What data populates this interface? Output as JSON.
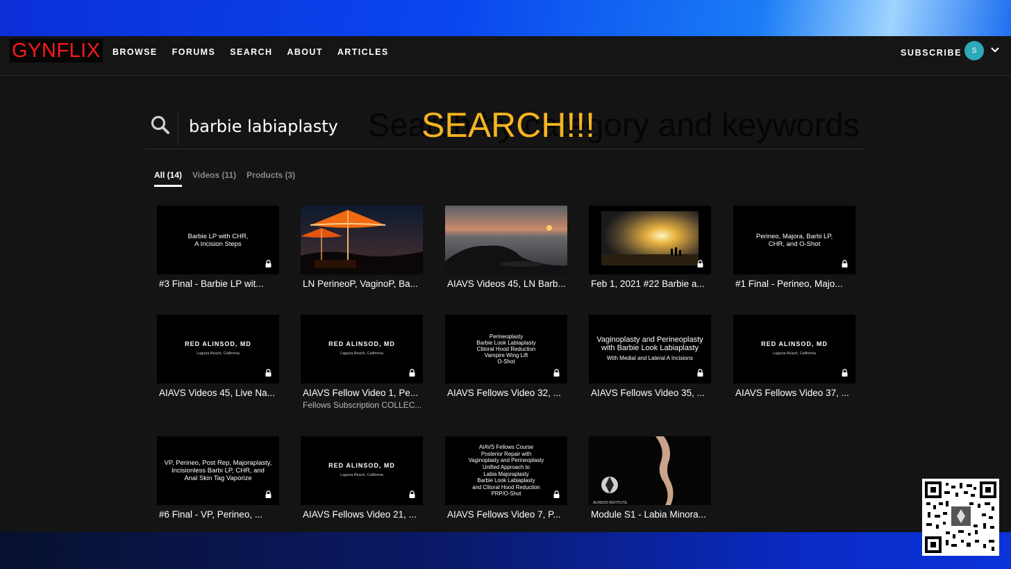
{
  "brand": {
    "logo": "GYNFLIX",
    "color": "#ff1a1a"
  },
  "nav": {
    "items": [
      "BROWSE",
      "FORUMS",
      "SEARCH",
      "ABOUT",
      "ARTICLES"
    ]
  },
  "header": {
    "subscribe": "SUBSCRIBE",
    "avatar_initial": "S",
    "avatar_color": "#2aa9b8"
  },
  "search": {
    "value": "barbie labiaplasty",
    "placeholder_visible": "Search by category and keywords",
    "overlay": "SEARCH!!!"
  },
  "tabs": [
    {
      "label": "All (14)",
      "active": true
    },
    {
      "label": "Videos (11)",
      "active": false
    },
    {
      "label": "Products (3)",
      "active": false
    }
  ],
  "results": [
    {
      "title": "#3 Final - Barbie LP wit...",
      "thumb": "Barbie LP with CHR,\nA Incision Steps",
      "kind": "text",
      "locked": true
    },
    {
      "title": "LN PerineoP, VaginoP, Ba...",
      "kind": "umbrella",
      "locked": false
    },
    {
      "title": "AIAVS Videos 45, LN Barb...",
      "kind": "seascape",
      "locked": false
    },
    {
      "title": "Feb 1, 2021 #22 Barbie a...",
      "kind": "sunset",
      "locked": true
    },
    {
      "title": "#1 Final - Perineo, Majo...",
      "thumb": "Perineo, Majora, Barbi LP,\nCHR, and O-Shot",
      "kind": "text",
      "locked": true
    },
    {
      "title": "AIAVS Videos 45, Live Na...",
      "thumb": "RED ALINSOD, MD",
      "thumb_sub": "Laguna Beach, California",
      "kind": "brand",
      "locked": true
    },
    {
      "title": "AIAVS Fellow Video 1, Pe...",
      "subtitle": "Fellows Subscription COLLEC...",
      "thumb": "RED ALINSOD, MD",
      "thumb_sub": "Laguna Beach, California",
      "kind": "brand",
      "locked": true
    },
    {
      "title": "AIAVS Fellows Video 32, ...",
      "thumb": "Perineoplasty\nBarbie Look Labiaplasty\nClitoral Hood Reduction\nVampire Wing Lift\nO-Shot",
      "kind": "text",
      "locked": true
    },
    {
      "title": "AIAVS Fellows Video 35, ...",
      "thumb": "Vaginoplasty and Perineoplasty\nwith Barbie Look Labiaplasty",
      "thumb_sub": "With Medial and Lateral A Incisions",
      "kind": "bigtext",
      "locked": true
    },
    {
      "title": "AIAVS Fellows Video 37, ...",
      "thumb": "RED ALINSOD, MD",
      "thumb_sub": "Laguna Beach, California",
      "kind": "brand",
      "locked": true
    },
    {
      "title": "#6 Final - VP, Perineo, ...",
      "thumb": "VP, Perineo, Post Rep, Majoraplasty,\nIncisionless Barbi LP, CHR, and\nAnal Skin Tag Vaporize",
      "kind": "text",
      "locked": true
    },
    {
      "title": "AIAVS Fellows Video 21, ...",
      "thumb": "RED ALINSOD, MD",
      "thumb_sub": "Laguna Beach, California",
      "kind": "brand",
      "locked": true
    },
    {
      "title": "AIAVS Fellows Video 7, P...",
      "thumb": "AIAVS Fellows Course\nPosterior Repair with\nVaginoplasty and Perineoplasty\nUnified Approach to\nLabia Majoraplasty\nBarbie Look Labiaplasty\nand Clitoral Hood Reduction\nPRP/O-Shot",
      "kind": "small",
      "locked": true
    },
    {
      "title": "Module S1 - Labia Minora...",
      "thumb_sub": "ALINSOD INSTITUTE",
      "kind": "figure",
      "locked": false
    }
  ],
  "colors": {
    "accent_overlay": "#f5b41f",
    "background": "#141414"
  }
}
